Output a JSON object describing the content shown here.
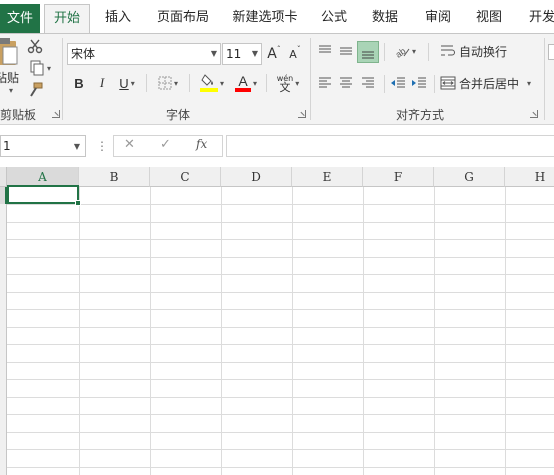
{
  "tabs": {
    "file": "文件",
    "home": "开始",
    "insert": "插入",
    "page_layout": "页面布局",
    "new_tab": "新建选项卡",
    "formulas": "公式",
    "data": "数据",
    "review": "审阅",
    "view": "视图",
    "developer": "开发"
  },
  "clipboard": {
    "paste_label": "粘贴",
    "group_label": "剪贴板"
  },
  "font": {
    "name": "宋体",
    "size": "11",
    "grow": "A",
    "shrink": "A",
    "bold": "B",
    "italic": "I",
    "underline": "U",
    "font_color_letter": "A",
    "phonetic": "wén",
    "group_label": "字体"
  },
  "alignment": {
    "wrap_text": "自动换行",
    "merge_center": "合并后居中",
    "group_label": "对齐方式"
  },
  "formula_bar": {
    "name_box": "1",
    "fx": "fx"
  },
  "columns": [
    "A",
    "B",
    "C",
    "D",
    "E",
    "F",
    "G",
    "H"
  ],
  "colors": {
    "accent": "#217346",
    "highlight_yellow": "#ffff00",
    "font_red": "#ff0000"
  }
}
